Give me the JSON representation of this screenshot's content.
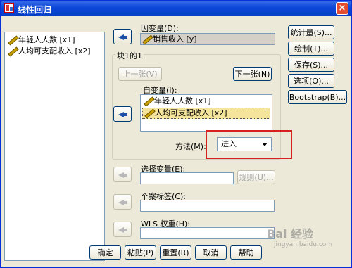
{
  "window": {
    "title": "线性回归"
  },
  "source_list": [
    {
      "label": "年轻人人数 [x1]"
    },
    {
      "label": "人均可支配收入 [x2]"
    }
  ],
  "dependent": {
    "label": "因变量(D):",
    "value": "销售收入 [y]"
  },
  "block": {
    "label": "块1的1",
    "prev_label": "上一张(V)",
    "next_label": "下一张(N)"
  },
  "independent": {
    "label": "自变量(I):",
    "items": [
      {
        "label": "年轻人人数 [x1]"
      },
      {
        "label": "人均可支配收入 [x2]"
      }
    ]
  },
  "method": {
    "label": "方法(M):",
    "value": "进入"
  },
  "selection": {
    "label": "选择变量(E):",
    "rule_label": "规则(U)..."
  },
  "case_labels": {
    "label": "个案标签(C):"
  },
  "wls": {
    "label": "WLS 权重(H):"
  },
  "side_buttons": [
    "统计量(S)...",
    "绘制(T)...",
    "保存(S)...",
    "选项(O)...",
    "Bootstrap(B)..."
  ],
  "bottom_buttons": [
    "确定",
    "粘贴(P)",
    "重置(R)",
    "取消",
    "帮助"
  ],
  "watermark": {
    "text": "Bai 经验",
    "url": "jingyan.baidu.com"
  },
  "colors": {
    "highlight": "#f5e49c",
    "annotation": "#d92020"
  }
}
